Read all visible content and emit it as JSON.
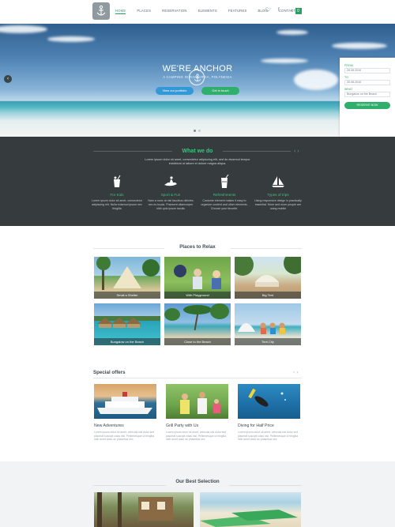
{
  "nav": {
    "items": [
      "Home",
      "Places",
      "Reservation",
      "Elements",
      "Features",
      "Blog",
      "Contact"
    ],
    "active_index": 0,
    "social_icons": [
      "twitter-icon",
      "facebook-icon"
    ],
    "cart_count": "0"
  },
  "hero": {
    "title": "WE'RE ANCHOR",
    "subtitle": "A CAMPING IN RANGIROA, POLYNESIA",
    "primary_button": "View our portfolio",
    "secondary_button": "Get in touch",
    "slide_count": 2,
    "active_slide": 0
  },
  "booking": {
    "from_label": "FROM",
    "from_value": "28.08.2016",
    "to_label": "TO",
    "to_value": "30.08.2016",
    "what_label": "WHAT",
    "what_value": "Bungalow on the Beach",
    "submit_label": "Reserve now"
  },
  "what_we_do": {
    "title": "What we do",
    "description": "Lorem ipsum dolor sit amet, consectetur adipiscing elit, sed do eiusmod tempor incididunt ut labore et dolore magna aliqua.",
    "features": [
      {
        "icon": "drink-icon",
        "title": "For Kids",
        "text": "Lorem ipsum dolor sit amet, consectetur adipiscing elit. Nulla euismod ipsum nec fringilla"
      },
      {
        "icon": "jetski-icon",
        "title": "Sport & Fun",
        "text": "Nam a nunc at nisl faucibus ultricies nec eu turpis. Praesent ullamcorper nibh quis ipsum iaculis"
      },
      {
        "icon": "cocktail-icon",
        "title": "Refreshments",
        "text": "Costume element makes it easy to organize content and other elements. Choose your favorite."
      },
      {
        "icon": "sailboat-icon",
        "title": "Types of trips",
        "text": "Using responsive design is practically essential. More and more people are using mobile"
      }
    ]
  },
  "places": {
    "title": "Places to Relax",
    "tiles": [
      "Small a Shelter",
      "With Playground",
      "Big Tent",
      "Bungalow on the Beach",
      "Close to the Beach",
      "Tent City"
    ]
  },
  "offers": {
    "title": "Special offers",
    "items": [
      {
        "title": "New Adventures",
        "text": "Lorem ipsum dolor sit amet, vehicula nisl dolor sed placerat suscipit class nisl. Pellentesque ut fringilla nibh amet dolor ac phasellus nec"
      },
      {
        "title": "Grill Party with Us",
        "text": "Lorem ipsum dolor sit amet, vehicula nisl dolor sed placerat suscipit class nisl. Pellentesque ut fringilla nibh amet dolor ac phasellus nec"
      },
      {
        "title": "Diving for Half Price",
        "text": "Lorem ipsum dolor sit amet, vehicula nisl dolor sed placerat suscipit class nisl. Pellentesque ut fringilla nibh amet dolor ac phasellus nec"
      }
    ]
  },
  "best": {
    "title": "Our Best Selection"
  },
  "colors": {
    "accent_green": "#2fae6c",
    "accent_blue": "#3399d6",
    "dark_band": "#363b3d"
  }
}
